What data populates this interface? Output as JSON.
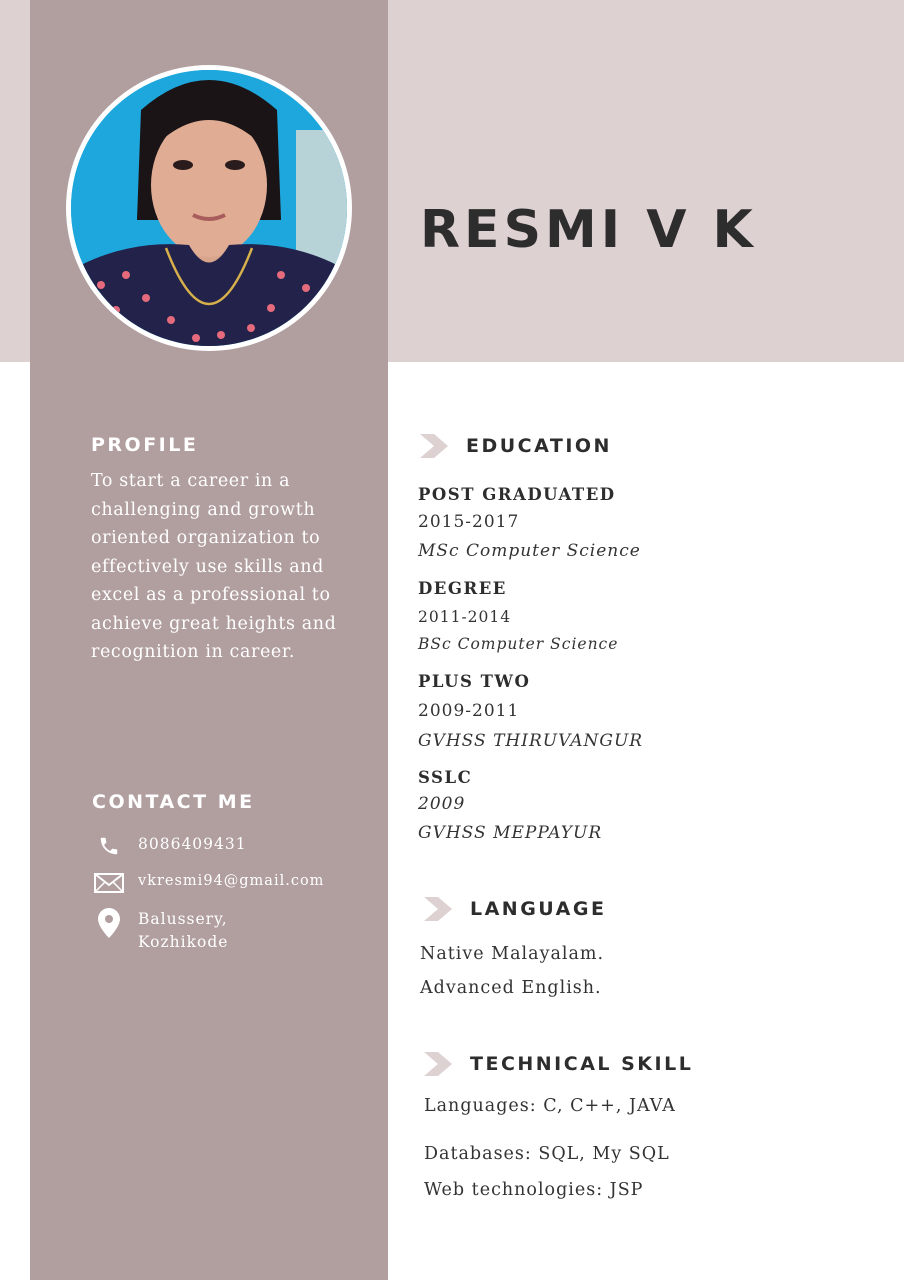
{
  "name": "RESMI V K",
  "profile": {
    "heading": "PROFILE",
    "text": "To start a career in a challenging and growth oriented organization to effectively use skills and excel as a professional to achieve great heights and recognition in career."
  },
  "contact": {
    "heading": "CONTACT ME",
    "phone": "8086409431",
    "email": "vkresmi94@gmail.com",
    "address_line1": "Balussery,",
    "address_line2": "Kozhikode"
  },
  "education": {
    "heading": "EDUCATION",
    "items": [
      {
        "title": "POST GRADUATED",
        "years": "2015-2017",
        "detail": "MSc Computer Science"
      },
      {
        "title": "DEGREE",
        "years": "2011-2014",
        "detail": "BSc Computer Science"
      },
      {
        "title": "PLUS TWO",
        "years": "2009-2011",
        "detail": "GVHSS THIRUVANGUR"
      },
      {
        "title": "SSLC",
        "years": "2009",
        "detail": "GVHSS MEPPAYUR"
      }
    ]
  },
  "language": {
    "heading": "LANGUAGE",
    "items": [
      "Native Malayalam.",
      "Advanced English."
    ]
  },
  "technical": {
    "heading": "TECHNICAL SKILL",
    "items": [
      "Languages: C, C++, JAVA",
      "Databases: SQL, My SQL",
      "Web technologies: JSP"
    ]
  },
  "colors": {
    "header_band": "#ddd1d2",
    "sidebar": "#b19e9f",
    "heading_text": "#2e2d2d",
    "chevron": "#ddd1d2"
  },
  "icons": {
    "phone": "phone-icon",
    "email": "envelope-icon",
    "location": "location-pin-icon",
    "section": "chevron-right-icon"
  }
}
